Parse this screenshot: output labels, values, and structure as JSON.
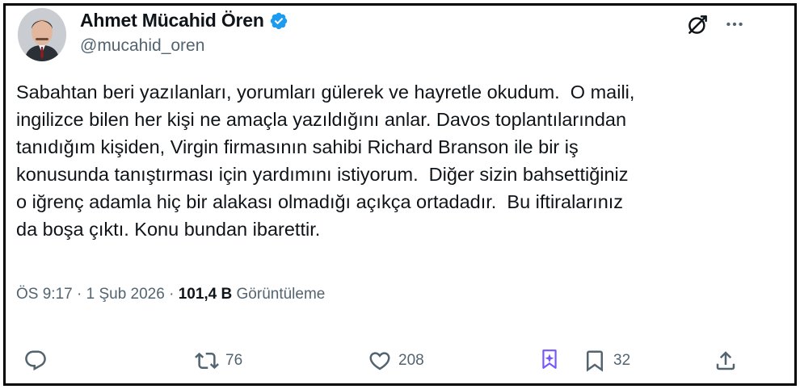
{
  "author": {
    "name": "Ahmet Mücahid Ören",
    "handle": "@mucahid_oren",
    "verified_color": "#1d9bf0"
  },
  "tweet": {
    "text": "Sabahtan beri yazılanları, yorumları gülerek ve hayretle okudum.  O maili,\ningilizce bilen her kişi ne amaçla yazıldığını anlar. Davos toplantılarından\ntanıdığım kişiden, Virgin firmasının sahibi Richard Branson ile bir iş\nkonusunda tanıştırması için yardımını istiyorum.  Diğer sizin bahsettiğiniz\no iğrenç adamla hiç bir alakası olmadığı açıkça ortadadır.  Bu iftiralarınız\nda boşa çıktı. Konu bundan ibarettir."
  },
  "meta": {
    "time": "ÖS 9:17",
    "sep1": " · ",
    "date": "1 Şub 2026",
    "sep2": " · ",
    "views_count": "101,4 B",
    "views_label": " Görüntüleme"
  },
  "actions": {
    "reply_count": "",
    "retweet_count": "76",
    "like_count": "208",
    "bookmark_count": "32"
  },
  "icons": {
    "reply": "reply-icon",
    "retweet": "retweet-icon",
    "like": "heart-icon",
    "grok": "grok-icon",
    "bookmark": "bookmark-icon",
    "share": "share-icon",
    "more": "more-icon",
    "verified": "verified-badge-icon"
  },
  "colors": {
    "text": "#0f1419",
    "secondary": "#536471",
    "grok_purple": "#7856ff",
    "border": "#000000"
  }
}
